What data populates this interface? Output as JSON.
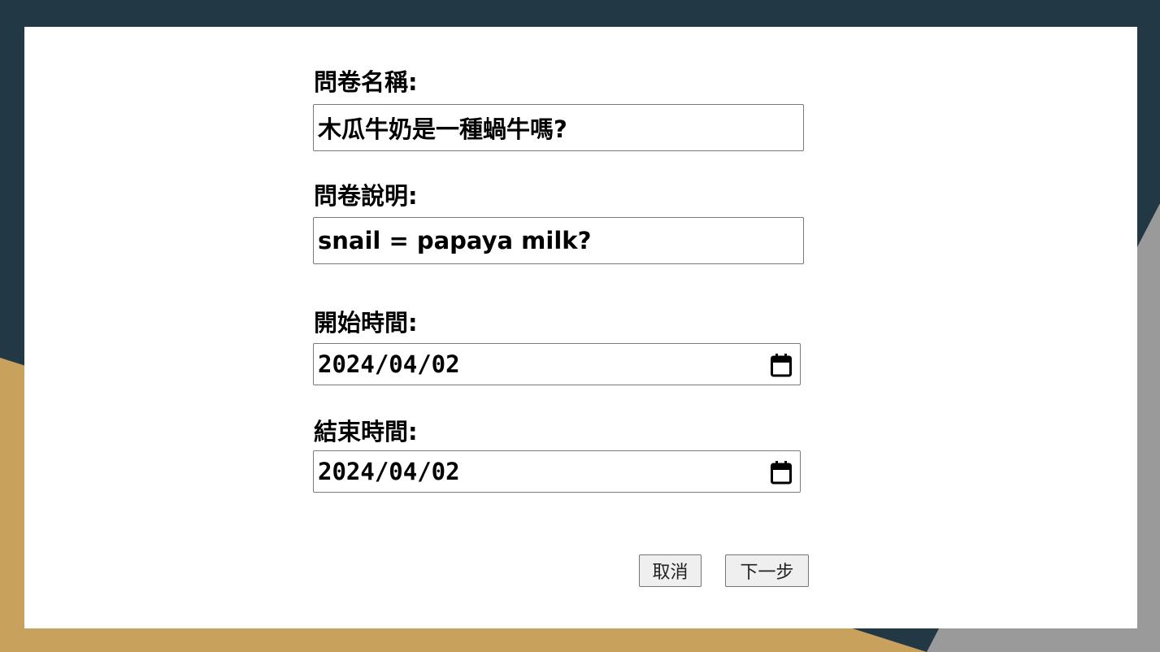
{
  "form": {
    "survey_name_label": "問卷名稱:",
    "survey_name_value": "木瓜牛奶是一種蝸牛嗎?",
    "survey_desc_label": "問卷說明:",
    "survey_desc_value": "snail = papaya milk?",
    "start_time_label": "開始時間:",
    "start_time_value": "2024/04/02",
    "end_time_label": "結束時間:",
    "end_time_value": "2024/04/02"
  },
  "actions": {
    "cancel_label": "取消",
    "next_label": "下一步"
  },
  "icons": {
    "date_picker": "calendar-icon"
  },
  "colors": {
    "backdrop_dark": "#233845",
    "backdrop_gold": "#C8A15C",
    "backdrop_grey": "#9A9A9A",
    "panel": "#FFFFFF"
  }
}
